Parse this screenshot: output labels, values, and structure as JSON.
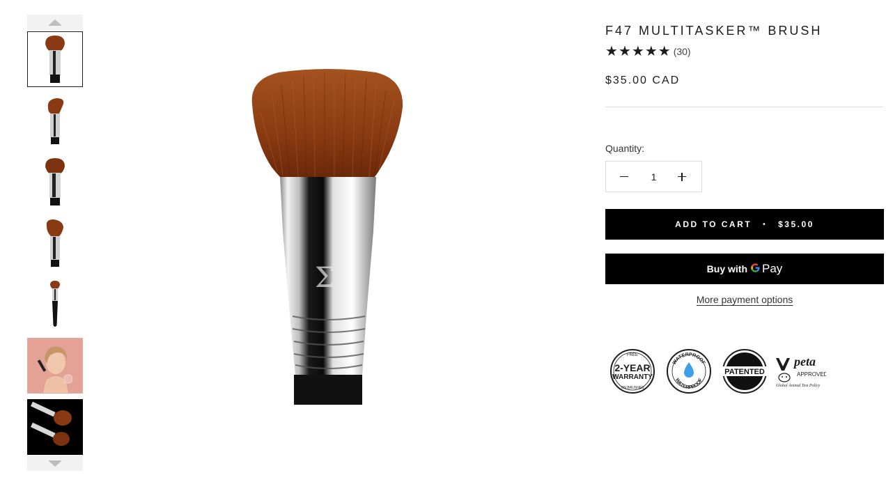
{
  "thumbnails": {
    "up_icon": "chevron-up-icon",
    "down_icon": "chevron-down-icon",
    "items": [
      {
        "name": "brush-angle-front",
        "active": true
      },
      {
        "name": "brush-angle-side"
      },
      {
        "name": "brush-angle-top"
      },
      {
        "name": "brush-angle-tilted"
      },
      {
        "name": "brush-full-length"
      },
      {
        "name": "model-lifestyle-photo"
      },
      {
        "name": "brushes-on-black"
      }
    ]
  },
  "product": {
    "title": "F47 MULTITASKER™ BRUSH",
    "rating_stars": 5,
    "rating_count": "(30)",
    "price": "$35.00 CAD"
  },
  "quantity": {
    "label": "Quantity:",
    "value": "1"
  },
  "add_to_cart": {
    "label": "ADD TO CART",
    "separator": "•",
    "price": "$35.00"
  },
  "gpay": {
    "buy_with": "Buy with",
    "pay": "Pay"
  },
  "more_payment_options": "More payment options",
  "badges": {
    "warranty_top": "FREE",
    "warranty_main1": "2-YEAR",
    "warranty_main2": "WARRANTY",
    "warranty_bottom": "ON BRUSHES",
    "waterproof_top": "WATERPROOF",
    "waterproof_bottom": "WATERPROOF",
    "patented": "PATENTED",
    "peta_main": "peta",
    "peta_approved": "APPROVED",
    "peta_policy": "Global Animal Test Policy"
  },
  "colors": {
    "bristle": "#8a3a12",
    "bristle_dark": "#5a2208",
    "ferrule": "#c9c9c9",
    "handle": "#111111",
    "gpay_blue": "#4285f4",
    "water_blue": "#3aa0e8"
  }
}
